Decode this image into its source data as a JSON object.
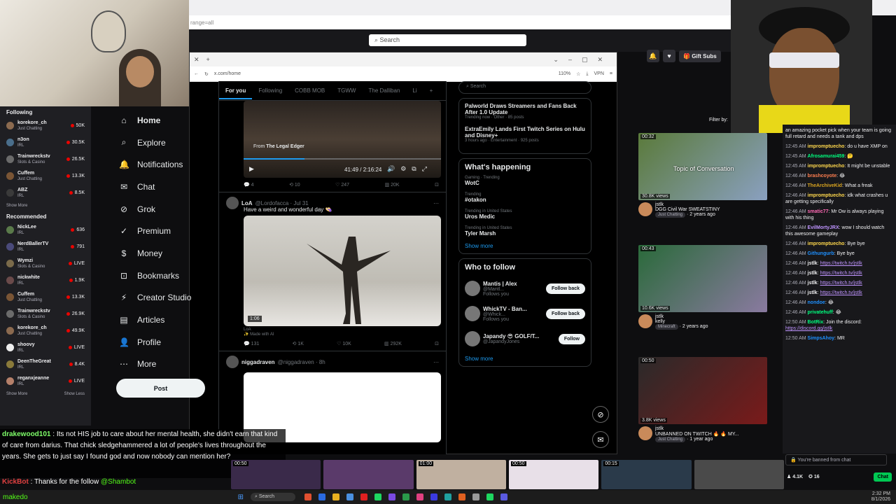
{
  "browser": {
    "url_fragment": "range=all",
    "search_placeholder": "Search",
    "x_address": "x.com/home",
    "zoom": "110%",
    "vpn": "VPN"
  },
  "twitch_top": {
    "gift_subs": "Gift Subs"
  },
  "twitch_left": {
    "following_title": "Following",
    "recommended_title": "Recommended",
    "show_more": "Show More",
    "show_less": "Show Less",
    "following": [
      {
        "name": "korekore_ch",
        "game": "Just Chatting",
        "viewers": "50K",
        "live": false,
        "color": "#8b6a4f"
      },
      {
        "name": "n3on",
        "game": "IRL",
        "viewers": "30.5K",
        "live": false,
        "color": "#4a6e8b"
      },
      {
        "name": "Trainwreckstv",
        "game": "Slots & Casino",
        "viewers": "26.5K",
        "live": false,
        "color": "#6b6b6b"
      },
      {
        "name": "Cuffem",
        "game": "Just Chatting",
        "viewers": "13.3K",
        "live": false,
        "color": "#7a5535"
      },
      {
        "name": "ABZ",
        "game": "IRL",
        "viewers": "8.5K",
        "live": false,
        "color": "#3a3a3a"
      }
    ],
    "recommended": [
      {
        "name": "NickLee",
        "game": "IRL",
        "viewers": "636",
        "live": false,
        "color": "#5a7a4a"
      },
      {
        "name": "NerdBallerTV",
        "game": "IRL",
        "viewers": "791",
        "live": false,
        "color": "#4a4a7a"
      },
      {
        "name": "Wymzi",
        "game": "Slots & Casino",
        "viewers": "LIVE",
        "live": true,
        "color": "#7a6a4a"
      },
      {
        "name": "nickwhite",
        "game": "IRL",
        "viewers": "1.9K",
        "live": false,
        "color": "#6a4a4a"
      },
      {
        "name": "Cuffem",
        "game": "Just Chatting",
        "viewers": "13.3K",
        "live": false,
        "color": "#7a5535"
      },
      {
        "name": "Trainwreckstv",
        "game": "Slots & Casino",
        "viewers": "26.9K",
        "live": false,
        "color": "#6b6b6b"
      },
      {
        "name": "korekore_ch",
        "game": "Just Chatting",
        "viewers": "49.9K",
        "live": false,
        "color": "#8b6a4f"
      },
      {
        "name": "shoovy",
        "game": "IRL",
        "viewers": "LIVE",
        "live": true,
        "color": "#eee"
      },
      {
        "name": "DeenTheGreat",
        "game": "IRL",
        "viewers": "8.4K",
        "live": false,
        "color": "#8a7a3a"
      },
      {
        "name": "reganxjeanne",
        "game": "IRL",
        "viewers": "LIVE",
        "live": true,
        "color": "#b5806a"
      }
    ]
  },
  "x_nav": [
    "Home",
    "Explore",
    "Notifications",
    "Chat",
    "Grok",
    "Premium",
    "Money",
    "Bookmarks",
    "Creator Studio",
    "Articles",
    "Profile",
    "More"
  ],
  "x_nav_icons": [
    "home-icon",
    "search-icon",
    "bell-icon",
    "chat-icon",
    "grok-icon",
    "premium-icon",
    "money-icon",
    "bookmark-icon",
    "creator-icon",
    "articles-icon",
    "profile-icon",
    "more-icon"
  ],
  "x_post": "Post",
  "feed": {
    "tabs": [
      "For you",
      "Following",
      "COBB MOB",
      "TGWW",
      "The Dalliban",
      "Li"
    ],
    "video": {
      "from_label": "From",
      "from_source": "The Legal Edger",
      "time": "41:49 / 2:16:24",
      "replies": "4",
      "reposts": "10",
      "likes": "247",
      "views": "20K"
    },
    "t1": {
      "name": "LoA",
      "handle": "@Lordofacca · Jul 31",
      "text": "Have a weird and wonderful day 👒",
      "duration": "1:06",
      "caption": "LoA",
      "ai": "Made with AI",
      "replies": "131",
      "reposts": "1K",
      "likes": "10K",
      "views": "292K"
    },
    "t2": {
      "name": "niggadraven",
      "handle": "@niggadraven · 8h"
    }
  },
  "right": {
    "search": "Search",
    "news": [
      {
        "t": "Palworld Draws Streamers and Fans Back After 1.0 Update",
        "m": "Trending now · Other · 85 posts"
      },
      {
        "t": "ExtraEmily Lands First Twitch Series on Hulu and Disney+",
        "m": "3 hours ago · Entertainment · 925 posts"
      }
    ],
    "happening_title": "What's happening",
    "trends": [
      {
        "c": "Gaming · Trending",
        "t": "WotC"
      },
      {
        "c": "Trending",
        "t": "#otakon"
      },
      {
        "c": "Trending in United States",
        "t": "Uros Medic"
      },
      {
        "c": "Trending in United States",
        "t": "Tyler Marsh"
      }
    ],
    "show_more": "Show more",
    "wtf_title": "Who to follow",
    "follow": [
      {
        "n": "Mantis | Alex",
        "h": "@Mantl...",
        "b": "Follow back",
        "fy": "Follows you"
      },
      {
        "n": "WhickTV - Ban...",
        "h": "@Whick...",
        "b": "Follow back",
        "fy": "Follows you"
      },
      {
        "n": "Japandy 😎 GOLF/T...",
        "h": "@JapandyJones",
        "b": "Follow",
        "fy": ""
      }
    ]
  },
  "vods": [
    {
      "dur": "00:32",
      "views": "30.8K views",
      "name": "jstlk",
      "title": "DGG Civil War SWEATSTINY",
      "tag": "Just Chatting",
      "age": "2 years ago",
      "overlay": "Topic of Conversation",
      "c1": "#5a7a3a",
      "c2": "#8aa0c0"
    },
    {
      "dur": "00:43",
      "views": "10.6K views",
      "name": "jstlk",
      "title": "kelly",
      "tag": "Minecraft",
      "age": "2 years ago",
      "overlay": "",
      "c1": "#2a6a3a",
      "c2": "#8a7aa0"
    },
    {
      "dur": "00:50",
      "views": "3.8K views",
      "name": "jstlk",
      "title": "UNBANNED ON TWITCH 🔥 🔥 MY...",
      "tag": "Just Chatting",
      "age": "1 year ago",
      "overlay": "",
      "c1": "#2a2a2a",
      "c2": "#7a1a1a"
    }
  ],
  "filter_by": "Filter by:",
  "chat": {
    "lines": [
      {
        "ts": "",
        "u": "",
        "c": "#efeff1",
        "m": "an amazing pocket pick when your team is going full retard and needs a tank and dps"
      },
      {
        "ts": "12:45 AM",
        "u": "impromptuecho",
        "c": "#ffd84d",
        "m": "do u have XMP on"
      },
      {
        "ts": "12:45 AM",
        "u": "Afrosamurai459",
        "c": "#00ff7f",
        "m": "🤔"
      },
      {
        "ts": "12:45 AM",
        "u": "impromptuecho",
        "c": "#ffd84d",
        "m": "It might be unstable"
      },
      {
        "ts": "12:46 AM",
        "u": "brashcoyote",
        "c": "#ff7f50",
        "m": "😂"
      },
      {
        "ts": "12:46 AM",
        "u": "TheArchiveKid",
        "c": "#daa520",
        "m": "What a freak"
      },
      {
        "ts": "12:46 AM",
        "u": "impromptuecho",
        "c": "#ffd84d",
        "m": "idk what crashes u are getting specifically"
      },
      {
        "ts": "12:46 AM",
        "u": "smatic77",
        "c": "#ff69b4",
        "m": "Mr Ow is always playing with his thing"
      },
      {
        "ts": "12:46 AM",
        "u": "EvilMortyJRX",
        "c": "#bf94ff",
        "m": "wow I should watch this awesome gameplay"
      },
      {
        "ts": "12:46 AM",
        "u": "impromptuecho",
        "c": "#ffd84d",
        "m": "Bye bye"
      },
      {
        "ts": "12:46 AM",
        "u": "Githungurb",
        "c": "#1e90ff",
        "m": "Bye bye"
      },
      {
        "ts": "12:46 AM",
        "u": "jstlk",
        "c": "#efeff1",
        "m": "",
        "link": "https://twitch.tv/jstlk"
      },
      {
        "ts": "12:46 AM",
        "u": "jstlk",
        "c": "#efeff1",
        "m": "",
        "link": "https://twitch.tv/jstlk"
      },
      {
        "ts": "12:46 AM",
        "u": "jstlk",
        "c": "#efeff1",
        "m": "",
        "link": "https://twitch.tv/jstlk"
      },
      {
        "ts": "12:46 AM",
        "u": "jstlk",
        "c": "#efeff1",
        "m": "",
        "link": "https://twitch.tv/jstlk"
      },
      {
        "ts": "12:46 AM",
        "u": "nondoe",
        "c": "#1e90ff",
        "m": "😂"
      },
      {
        "ts": "12:46 AM",
        "u": "privatehuff",
        "c": "#00ff7f",
        "m": "😂"
      },
      {
        "ts": "12:50 AM",
        "u": "BotRix",
        "c": "#00ff7f",
        "m": "Join the discord:",
        "link": "https://discord.gg/jstlk"
      },
      {
        "ts": "12:50 AM",
        "u": "SimpsAhoy",
        "c": "#1e90ff",
        "m": "MR"
      }
    ],
    "banned": "You're banned from chat",
    "viewers": "4.1K",
    "points": "16",
    "chat_btn": "Chat"
  },
  "overlay_msg": {
    "user": "drakewood101",
    "text": "Its not HIS job to care about her mental health, she didn't earn that kind of care from darius. That chick sledgehammered a lot of people's lives throughout the years. She gets to just say I found god and now nobody can mention her?"
  },
  "kick": {
    "user": "KickBot",
    "text": "Thanks for the follow",
    "mention": "@Shambot",
    "user2": "makedo"
  },
  "clips": [
    {
      "t": "00:50"
    },
    {
      "t": ""
    },
    {
      "t": "01:00"
    },
    {
      "t": "00:50"
    },
    {
      "t": "00:15"
    },
    {
      "t": ""
    }
  ],
  "taskbar": {
    "search": "Search",
    "time": "2:32 PM",
    "date": "8/1/2026"
  }
}
